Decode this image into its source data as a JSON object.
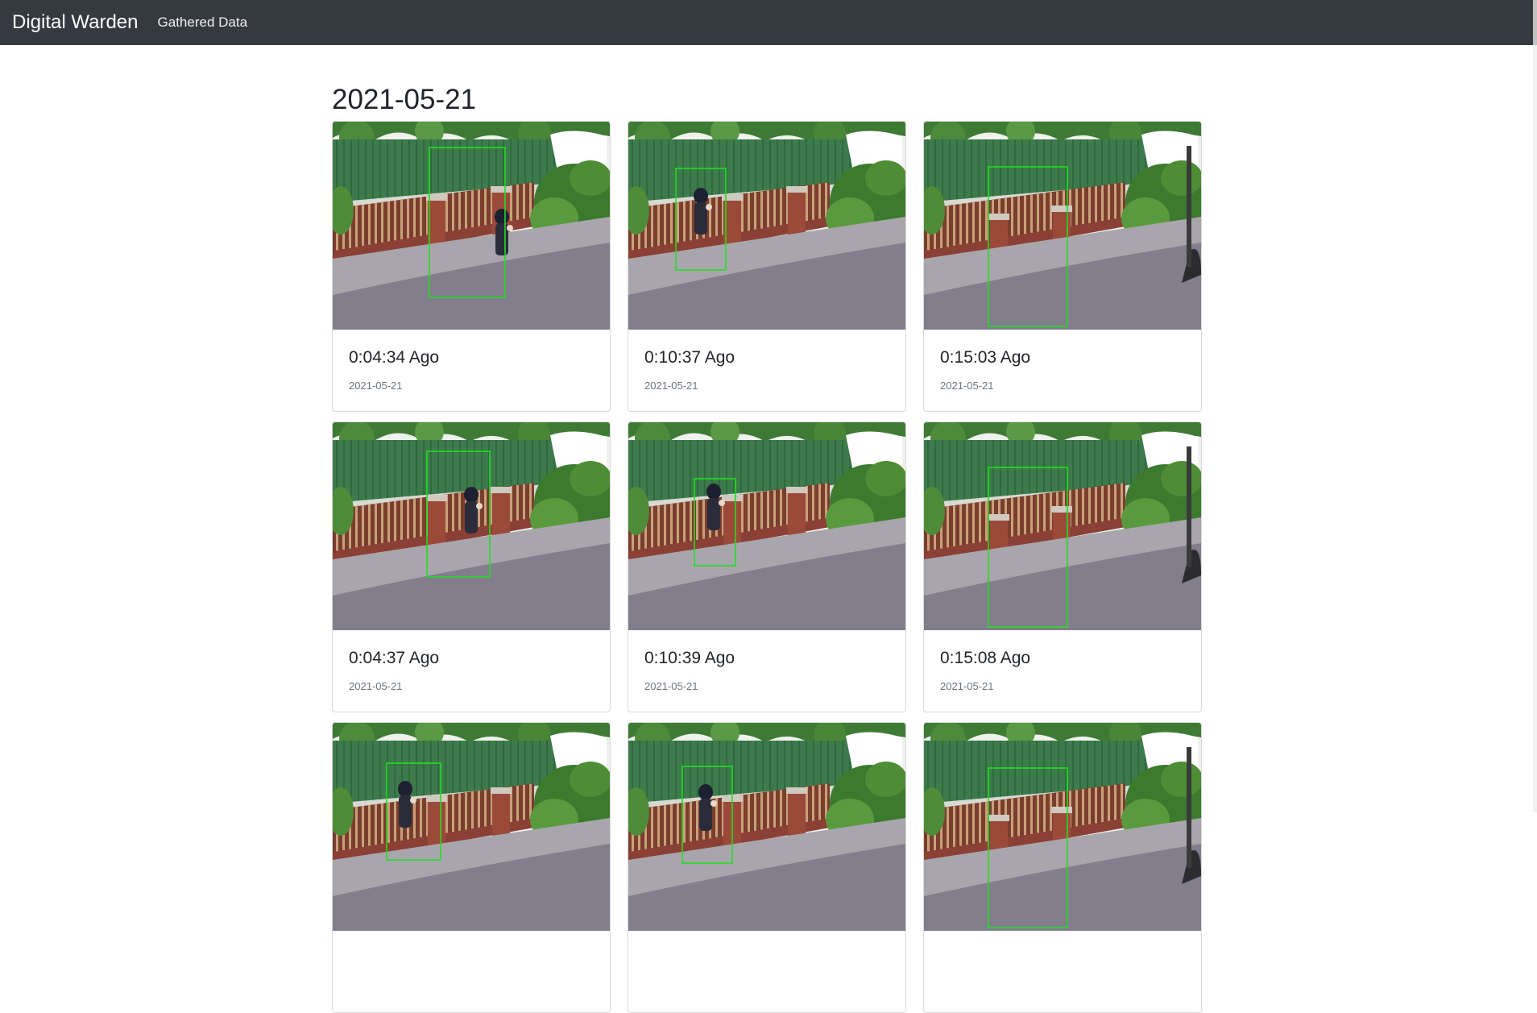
{
  "navbar": {
    "brand": "Digital Warden",
    "links": [
      "Gathered Data"
    ],
    "background": "#343a40"
  },
  "section": {
    "date_heading": "2021-05-21"
  },
  "cards": [
    {
      "title": "0:04:34 Ago",
      "date": "2021-05-21",
      "variant": "left-gate-a"
    },
    {
      "title": "0:10:37 Ago",
      "date": "2021-05-21",
      "variant": "mid-gate-a"
    },
    {
      "title": "0:15:03 Ago",
      "date": "2021-05-21",
      "variant": "right-gate"
    },
    {
      "title": "0:04:37 Ago",
      "date": "2021-05-21",
      "variant": "left-gate-b"
    },
    {
      "title": "0:10:39 Ago",
      "date": "2021-05-21",
      "variant": "mid-gate-b"
    },
    {
      "title": "0:15:08 Ago",
      "date": "2021-05-21",
      "variant": "right-gate"
    },
    {
      "title": "",
      "date": "",
      "variant": "left-gate-c"
    },
    {
      "title": "",
      "date": "",
      "variant": "mid-gate-c"
    },
    {
      "title": "",
      "date": "",
      "variant": "right-gate"
    }
  ],
  "colors": {
    "detection_box": "#22dd22",
    "muted_text": "#6c757d"
  }
}
